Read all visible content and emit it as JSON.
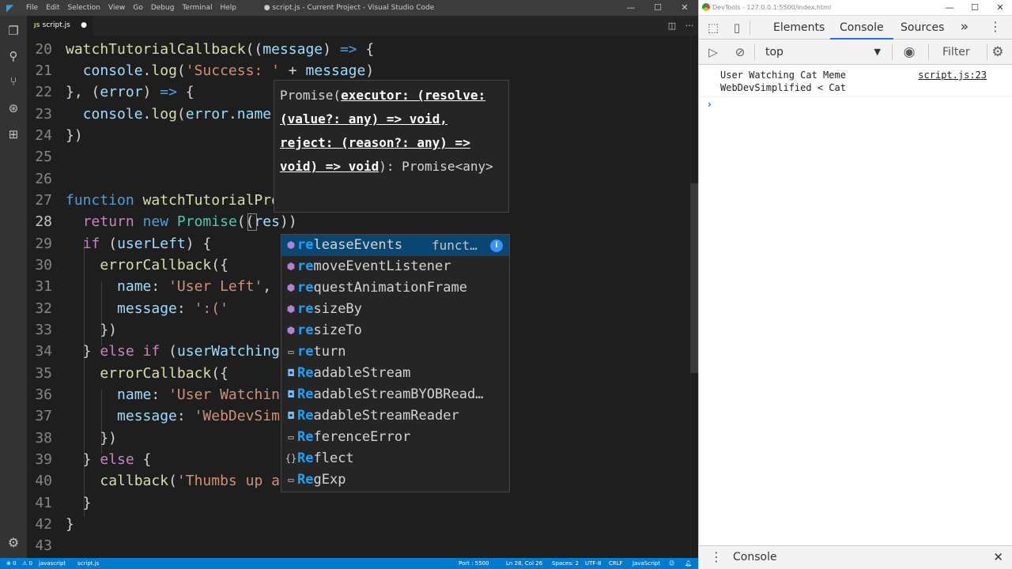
{
  "vscode": {
    "menu": [
      "File",
      "Edit",
      "Selection",
      "View",
      "Go",
      "Debug",
      "Terminal",
      "Help"
    ],
    "window_title": "● script.js - Current Project - Visual Studio Code",
    "tab": {
      "badge": "JS",
      "label": "script.js",
      "dirty": "●"
    },
    "status": {
      "errors": "⊗ 0",
      "warnings": "⚠ 0",
      "language_crumb": "javascript",
      "file_crumb": "script.js",
      "port": "Port : 5500",
      "position": "Ln 28, Col 26",
      "spaces": "Spaces: 2",
      "encoding": "UTF-8",
      "eol": "CRLF",
      "language": "JavaScript"
    },
    "signature_hint": {
      "prefix": "Promise(",
      "param": "executor: (resolve: (value?: any) => void, reject: (reason?: any) => void) => void",
      "suffix": "): Promise<any>"
    },
    "suggestions": [
      {
        "match": "re",
        "rest": "leaseEvents",
        "detail": "funct…",
        "kind": "method"
      },
      {
        "match": "re",
        "rest": "moveEventListener",
        "kind": "method"
      },
      {
        "match": "re",
        "rest": "questAnimationFrame",
        "kind": "method"
      },
      {
        "match": "re",
        "rest": "sizeBy",
        "kind": "method"
      },
      {
        "match": "re",
        "rest": "sizeTo",
        "kind": "method"
      },
      {
        "match": "re",
        "rest": "turn",
        "kind": "keyword"
      },
      {
        "match": "Re",
        "rest": "adableStream",
        "kind": "variable"
      },
      {
        "match": "Re",
        "rest": "adableStreamBYOBRead…",
        "kind": "variable"
      },
      {
        "match": "Re",
        "rest": "adableStreamReader",
        "kind": "variable"
      },
      {
        "match": "Re",
        "rest": "ferenceError",
        "kind": "class"
      },
      {
        "match": "Re",
        "rest": "flect",
        "kind": "module"
      },
      {
        "match": "Re",
        "rest": "gExp",
        "kind": "class"
      }
    ]
  },
  "devtools": {
    "title": "DevTools - 127.0.0.1:5500/index.html",
    "tabs": [
      "Elements",
      "Console",
      "Sources"
    ],
    "active_tab": "Console",
    "more": "»",
    "context": "top",
    "filter_placeholder": "Filter",
    "messages": [
      {
        "line1": "User Watching Cat Meme",
        "line2": "WebDevSimplified < Cat",
        "source": "script.js:23"
      }
    ],
    "drawer_tab": "Console"
  }
}
